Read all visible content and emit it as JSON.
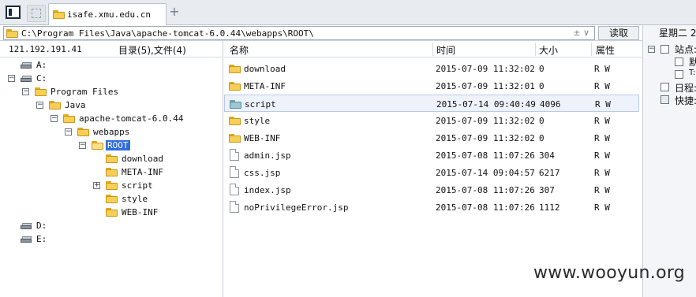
{
  "tabs": [
    {
      "label": "isafe.xmu.edu.cn"
    }
  ],
  "address_bar": {
    "path": "C:\\Program Files\\Java\\apache-tomcat-6.0.44\\webapps\\ROOT\\",
    "controls": "± ∨",
    "read_button": "读取"
  },
  "left_panel": {
    "ip": "121.192.191.41",
    "counts": "目录(5),文件(4)",
    "tree": [
      {
        "label": "A:",
        "icon": "drive-icon",
        "expander": ""
      },
      {
        "label": "C:",
        "icon": "drive-icon",
        "expander": "−"
      },
      {
        "label": "Program Files",
        "icon": "folder-icon",
        "expander": "−"
      },
      {
        "label": "Java",
        "icon": "folder-icon",
        "expander": "−"
      },
      {
        "label": "apache-tomcat-6.0.44",
        "icon": "folder-icon",
        "expander": "−"
      },
      {
        "label": "webapps",
        "icon": "folder-icon",
        "expander": "−"
      },
      {
        "label": "ROOT",
        "icon": "folder-open-icon",
        "expander": "−",
        "selected": true
      },
      {
        "label": "download",
        "icon": "folder-icon",
        "expander": ""
      },
      {
        "label": "META-INF",
        "icon": "folder-icon",
        "expander": ""
      },
      {
        "label": "script",
        "icon": "folder-icon",
        "expander": "+"
      },
      {
        "label": "style",
        "icon": "folder-icon",
        "expander": ""
      },
      {
        "label": "WEB-INF",
        "icon": "folder-icon",
        "expander": ""
      },
      {
        "label": "D:",
        "icon": "drive-icon",
        "expander": ""
      },
      {
        "label": "E:",
        "icon": "drive-icon",
        "expander": ""
      }
    ]
  },
  "file_list": {
    "columns": [
      "名称",
      "时间",
      "大小",
      "属性"
    ],
    "rows": [
      {
        "name": "download",
        "time": "2015-07-09 11:32:02",
        "size": "0",
        "attr": "R W",
        "type": "folder"
      },
      {
        "name": "META-INF",
        "time": "2015-07-09 11:32:01",
        "size": "0",
        "attr": "R W",
        "type": "folder"
      },
      {
        "name": "script",
        "time": "2015-07-14 09:40:49",
        "size": "4096",
        "attr": "R W",
        "type": "folder",
        "selected": true
      },
      {
        "name": "style",
        "time": "2015-07-09 11:32:02",
        "size": "0",
        "attr": "R W",
        "type": "folder"
      },
      {
        "name": "WEB-INF",
        "time": "2015-07-09 11:32:02",
        "size": "0",
        "attr": "R W",
        "type": "folder"
      },
      {
        "name": "admin.jsp",
        "time": "2015-07-08 11:07:26",
        "size": "304",
        "attr": "R W",
        "type": "file"
      },
      {
        "name": "css.jsp",
        "time": "2015-07-14 09:04:57",
        "size": "6217",
        "attr": "R W",
        "type": "file"
      },
      {
        "name": "index.jsp",
        "time": "2015-07-08 11:07:26",
        "size": "307",
        "attr": "R W",
        "type": "file"
      },
      {
        "name": "noPrivilegeError.jsp",
        "time": "2015-07-08 11:07:26",
        "size": "1112",
        "attr": "R W",
        "type": "file"
      }
    ]
  },
  "right_panel": {
    "weekday": "星期二 2",
    "items": [
      {
        "label": "站点:",
        "expander": "−"
      },
      {
        "label": "默",
        "box": true
      },
      {
        "label": "T:",
        "box": true
      },
      {
        "label": "日程:",
        "icon": "calendar-icon"
      },
      {
        "label": "快捷:",
        "icon": "shortcut-icon"
      }
    ]
  },
  "watermark": "www.wooyun.org",
  "colors": {
    "selection": "#2f6ddd",
    "folder": "#f6cf56",
    "row_highlight": "#eef3fb"
  }
}
